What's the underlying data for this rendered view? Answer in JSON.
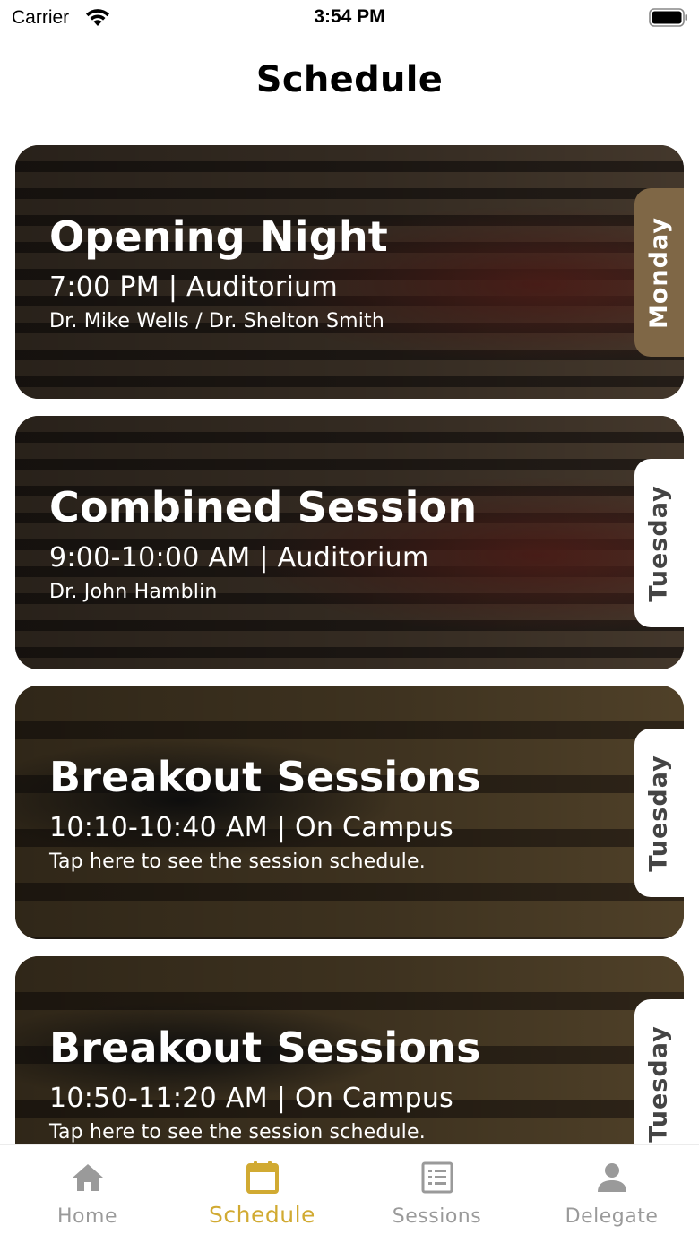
{
  "status_bar": {
    "carrier": "Carrier",
    "time": "3:54 PM"
  },
  "header": {
    "title": "Schedule"
  },
  "cards": [
    {
      "title": "Opening Night",
      "time": "7:00 PM | Auditorium",
      "subtitle": "Dr. Mike Wells / Dr. Shelton Smith",
      "day": "Monday",
      "day_selected": true
    },
    {
      "title": "Combined Session",
      "time": "9:00-10:00 AM | Auditorium",
      "subtitle": "Dr. John Hamblin",
      "day": "Tuesday",
      "day_selected": false
    },
    {
      "title": "Breakout Sessions",
      "time": "10:10-10:40 AM | On Campus",
      "subtitle": "Tap here to see the session schedule.",
      "day": "Tuesday",
      "day_selected": false
    },
    {
      "title": "Breakout Sessions",
      "time": "10:50-11:20 AM | On Campus",
      "subtitle": "Tap here to see the session schedule.",
      "day": "Tuesday",
      "day_selected": false
    }
  ],
  "tab_bar": {
    "active_tab": "Schedule",
    "tabs": [
      {
        "label": "Home",
        "icon": "home-icon"
      },
      {
        "label": "Schedule",
        "icon": "calendar-icon"
      },
      {
        "label": "Sessions",
        "icon": "list-icon"
      },
      {
        "label": "Delegate",
        "icon": "person-icon"
      }
    ]
  },
  "colors": {
    "accent": "#d1aa32",
    "day_tab_selected": "#7f6746",
    "tab_inactive": "#9a9a9a"
  }
}
